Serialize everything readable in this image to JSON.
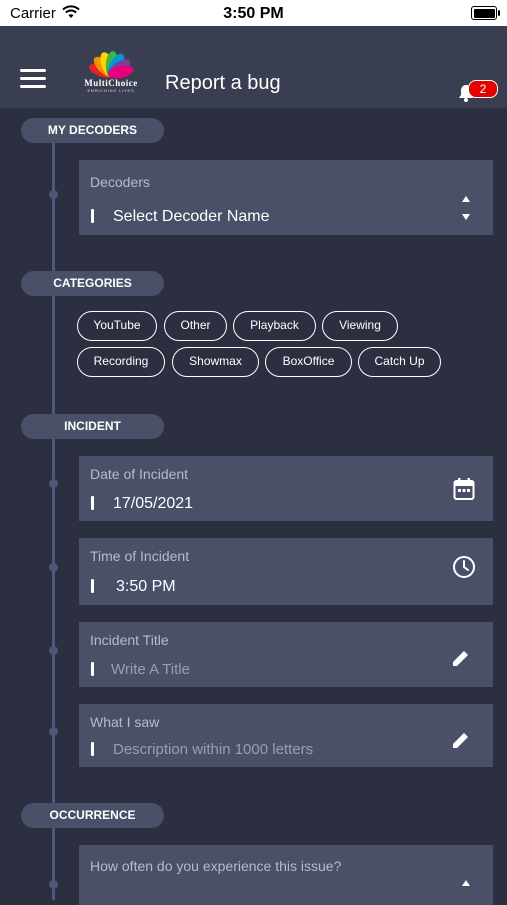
{
  "status_bar": {
    "carrier": "Carrier",
    "time": "3:50 PM"
  },
  "app_bar": {
    "logo_text": "MultiChoice",
    "logo_tagline": "ENRICHING LIVES",
    "title": "Report a bug",
    "notification_count": "2"
  },
  "sections": {
    "decoders": "MY DECODERS",
    "categories": "CATEGORIES",
    "incident": "INCIDENT",
    "occurrence": "OCCURRENCE"
  },
  "decoder_field": {
    "label": "Decoders",
    "value": "Select Decoder Name"
  },
  "categories": [
    "YouTube",
    "Other",
    "Playback",
    "Viewing",
    "Recording",
    "Showmax",
    "BoxOffice",
    "Catch Up"
  ],
  "incident": {
    "date_label": "Date of Incident",
    "date_value": "17/05/2021",
    "time_label": "Time of Incident",
    "time_value": "3:50 PM",
    "title_label": "Incident Title",
    "title_placeholder": "Write A Title",
    "desc_label": "What I saw",
    "desc_placeholder": "Description within 1000 letters"
  },
  "occurrence": {
    "question": "How often do you experience this issue?"
  },
  "colors": {
    "background": "#2b2f40",
    "card": "#4a5068",
    "header": "#3a3e51",
    "badge": "#e60000"
  }
}
